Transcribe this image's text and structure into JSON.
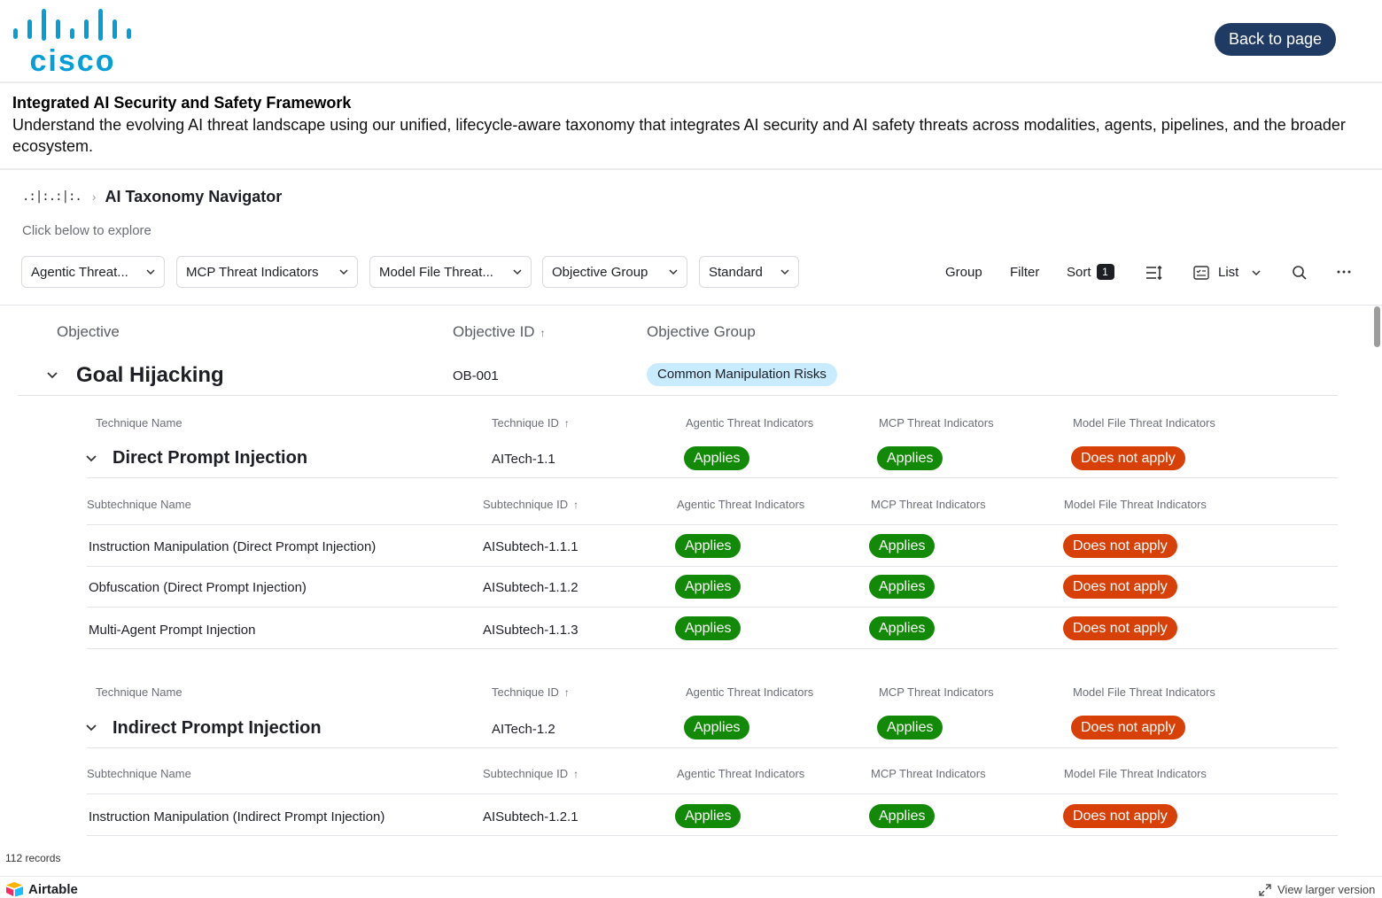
{
  "header": {
    "logo_text": "cisco",
    "back_button": "Back to page"
  },
  "intro": {
    "title": "Integrated AI Security and Safety Framework",
    "description": "Understand the evolving AI threat landscape using our unified, lifecycle-aware taxonomy that integrates AI security and AI safety threats across modalities, agents, pipelines, and the broader ecosystem."
  },
  "navigator": {
    "breadcrumb_icon": ".:|:.:|:.",
    "title": "AI Taxonomy Navigator",
    "hint": "Click below to explore"
  },
  "filters": [
    "Agentic Threat...",
    "MCP Threat Indicators",
    "Model File Threat...",
    "Objective Group",
    "Standard"
  ],
  "toolbar": {
    "group": "Group",
    "filter": "Filter",
    "sort": "Sort",
    "sort_count": "1",
    "view": "List"
  },
  "columns": {
    "objective": "Objective",
    "objective_id": "Objective ID",
    "objective_group": "Objective Group",
    "technique_name": "Technique Name",
    "technique_id": "Technique ID",
    "agentic": "Agentic Threat Indicators",
    "mcp": "MCP Threat Indicators",
    "model_file": "Model File Threat Indicators",
    "subtechnique_name": "Subtechnique Name",
    "subtechnique_id": "Subtechnique ID"
  },
  "objective": {
    "name": "Goal Hijacking",
    "id": "OB-001",
    "group": "Common Manipulation Risks"
  },
  "techniques": [
    {
      "name": "Direct Prompt Injection",
      "id": "AITech-1.1",
      "agentic": "Applies",
      "mcp": "Applies",
      "model_file": "Does not apply",
      "subtechniques": [
        {
          "name": "Instruction Manipulation (Direct Prompt Injection)",
          "id": "AISubtech-1.1.1",
          "agentic": "Applies",
          "mcp": "Applies",
          "model_file": "Does not apply"
        },
        {
          "name": "Obfuscation (Direct Prompt Injection)",
          "id": "AISubtech-1.1.2",
          "agentic": "Applies",
          "mcp": "Applies",
          "model_file": "Does not apply"
        },
        {
          "name": "Multi-Agent Prompt Injection",
          "id": "AISubtech-1.1.3",
          "agentic": "Applies",
          "mcp": "Applies",
          "model_file": "Does not apply"
        }
      ]
    },
    {
      "name": "Indirect Prompt Injection",
      "id": "AITech-1.2",
      "agentic": "Applies",
      "mcp": "Applies",
      "model_file": "Does not apply",
      "subtechniques": [
        {
          "name": "Instruction Manipulation (Indirect Prompt Injection)",
          "id": "AISubtech-1.2.1",
          "agentic": "Applies",
          "mcp": "Applies",
          "model_file": "Does not apply"
        }
      ]
    }
  ],
  "footer": {
    "records": "112 records",
    "brand": "Airtable",
    "view_larger": "View larger version"
  },
  "colors": {
    "applies": "#138a07",
    "does_not_apply": "#d74108",
    "group_pill": "#c9ebff",
    "back_button": "#1f3b63",
    "cisco_blue": "#049fd9"
  }
}
